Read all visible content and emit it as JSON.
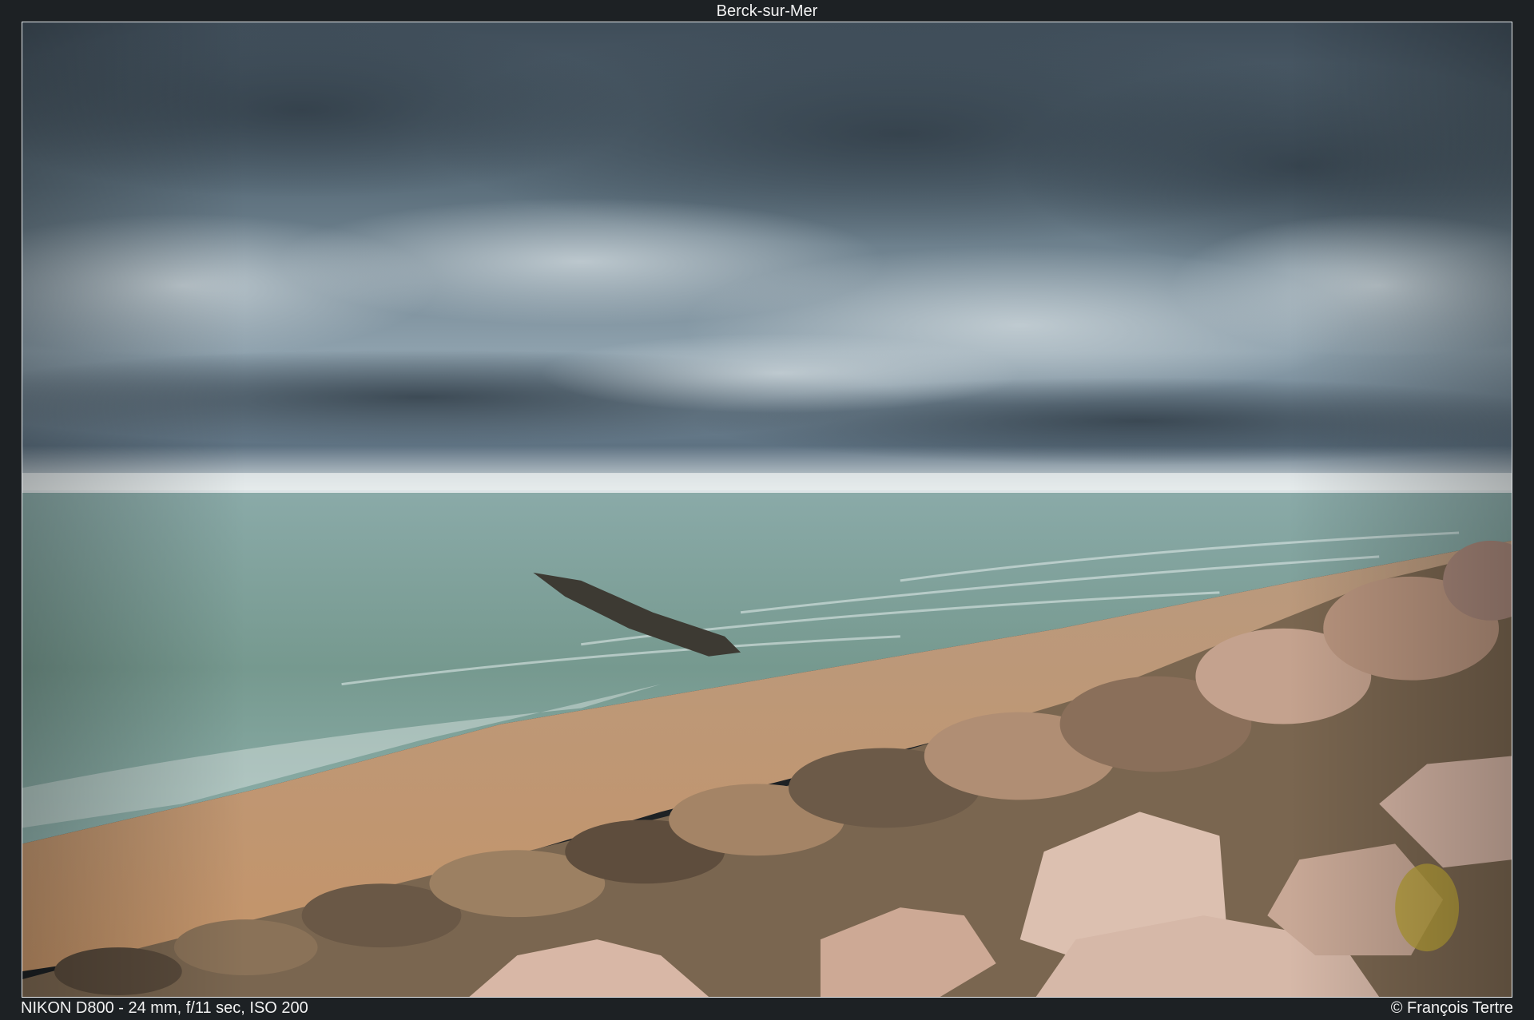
{
  "photo": {
    "title": "Berck-sur-Mer",
    "exif": "NIKON D800 - 24 mm, f/11 sec, ISO 200",
    "credit": "© François Tertre"
  },
  "colors": {
    "sky_dark": "#4a5966",
    "sky_mid": "#7f93a0",
    "horizon_light": "#eef3f4",
    "sea": "#7fa3a0",
    "sea_deep": "#6f9290",
    "sand": "#c9a07a",
    "rock_light": "#d9b8a6",
    "rock_dark": "#6e5a48"
  }
}
